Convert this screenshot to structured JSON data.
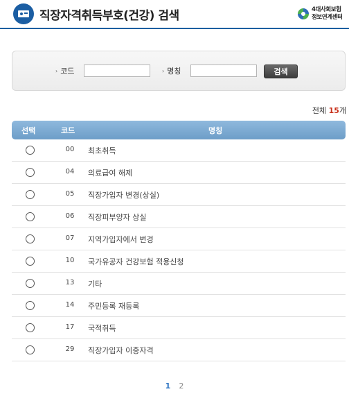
{
  "header": {
    "title": "직장자격취득부호(건강) 검색",
    "logo_line1": "4대사회보험",
    "logo_line2": "정보연계센터"
  },
  "search": {
    "code_label": "코드",
    "code_value": "",
    "name_label": "명칭",
    "name_value": "",
    "button_label": "검색"
  },
  "summary": {
    "prefix": "전체 ",
    "count": "15",
    "suffix": "개"
  },
  "table": {
    "columns": [
      "선택",
      "코드",
      "명칭"
    ],
    "rows": [
      {
        "code": "00",
        "name": "최초취득"
      },
      {
        "code": "04",
        "name": "의료급여 해제"
      },
      {
        "code": "05",
        "name": "직장가입자 변경(상실)"
      },
      {
        "code": "06",
        "name": "직장피부양자 상실"
      },
      {
        "code": "07",
        "name": "지역가입자에서 변경"
      },
      {
        "code": "10",
        "name": "국가유공자 건강보험 적용신청"
      },
      {
        "code": "13",
        "name": "기타"
      },
      {
        "code": "14",
        "name": "주민등록 재등록"
      },
      {
        "code": "17",
        "name": "국적취득"
      },
      {
        "code": "29",
        "name": "직장가입자 이중자격"
      }
    ]
  },
  "pagination": {
    "pages": [
      "1",
      "2"
    ],
    "current": "1"
  },
  "colors": {
    "accent": "#1b5ea3",
    "table_header": "#7eabd3",
    "count_highlight": "#c8311b",
    "active_page": "#2b73c2"
  }
}
